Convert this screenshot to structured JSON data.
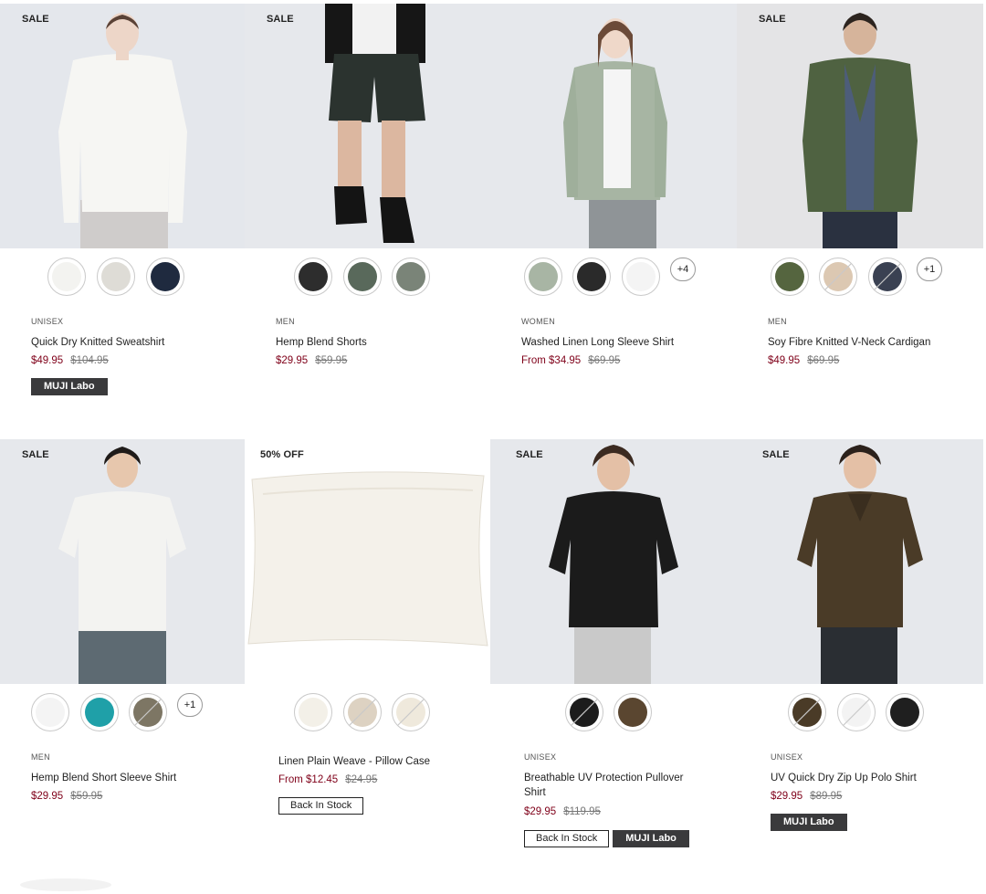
{
  "products": [
    {
      "badge": "SALE",
      "category": "UNISEX",
      "name": "Quick Dry Knitted Sweatshirt",
      "price": "$49.95",
      "was": "$104.95",
      "tags": [
        "MUJI Labo"
      ],
      "swatch_more": ""
    },
    {
      "badge": "SALE",
      "category": "MEN",
      "name": "Hemp Blend Shorts",
      "price": "$29.95",
      "was": "$59.95",
      "tags": [],
      "swatch_more": ""
    },
    {
      "badge": "",
      "category": "WOMEN",
      "name": "Washed Linen Long Sleeve Shirt",
      "price": "From $34.95",
      "was": "$69.95",
      "tags": [],
      "swatch_more": "+4"
    },
    {
      "badge": "SALE",
      "category": "MEN",
      "name": "Soy Fibre Knitted V-Neck Cardigan",
      "price": "$49.95",
      "was": "$69.95",
      "tags": [],
      "swatch_more": "+1"
    },
    {
      "badge": "SALE",
      "category": "MEN",
      "name": "Hemp Blend Short Sleeve Shirt",
      "price": "$29.95",
      "was": "$59.95",
      "tags": [],
      "swatch_more": "+1"
    },
    {
      "badge": "50% OFF",
      "category": "",
      "name": "Linen Plain Weave - Pillow Case",
      "price": "From $12.45",
      "was": "$24.95",
      "tags": [
        "Back In Stock"
      ],
      "swatch_more": ""
    },
    {
      "badge": "SALE",
      "category": "UNISEX",
      "name": "Breathable UV Protection Pullover Shirt",
      "price": "$29.95",
      "was": "$119.95",
      "tags": [
        "Back In Stock",
        "MUJI Labo"
      ],
      "swatch_more": ""
    },
    {
      "badge": "SALE",
      "category": "UNISEX",
      "name": "UV Quick Dry Zip Up Polo Shirt",
      "price": "$29.95",
      "was": "$89.95",
      "tags": [
        "MUJI Labo"
      ],
      "swatch_more": ""
    }
  ],
  "colors": {
    "sale_price": "#7f0019",
    "tag_dark": "#3a3a3c",
    "photo_background": "#e6e8ec"
  }
}
